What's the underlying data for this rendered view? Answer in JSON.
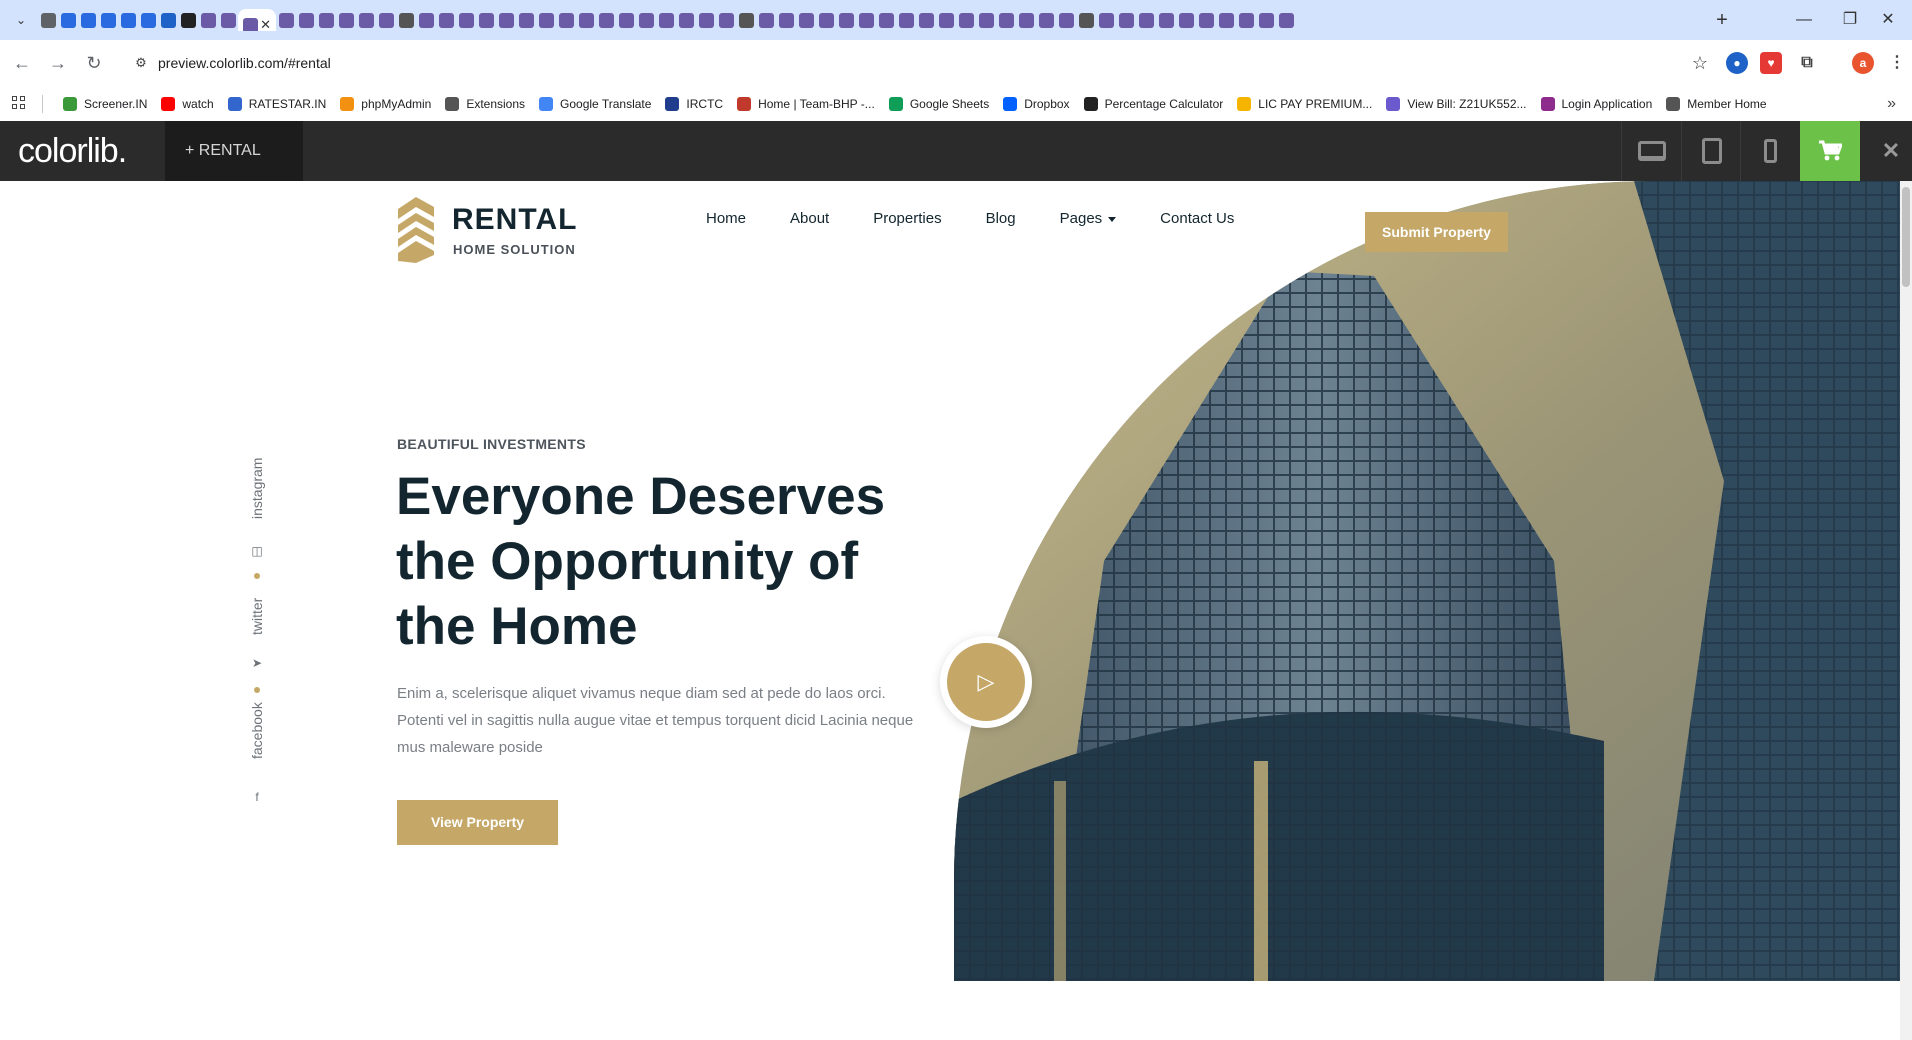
{
  "browser": {
    "colors": {
      "tabstrip": "#d3e3fd",
      "toolbar": "#ffffff"
    },
    "url": "preview.colorlib.com/#rental",
    "active_tab_close": "✕",
    "new_tab": "+",
    "window": {
      "minimize": "—",
      "restore": "❐",
      "close": "✕"
    },
    "nav": {
      "back": "←",
      "forward": "→",
      "reload": "↻"
    },
    "star": "☆",
    "profile_initial": "a",
    "menu": "⋮",
    "bookmarks": [
      {
        "label": "Screener.IN",
        "icon": "screener-icon",
        "color": "#3a9a3a"
      },
      {
        "label": "watch",
        "icon": "youtube-icon",
        "color": "#ff0000"
      },
      {
        "label": "RATESTAR.IN",
        "icon": "ratestar-icon",
        "color": "#3366cc"
      },
      {
        "label": "phpMyAdmin",
        "icon": "phpmyadmin-icon",
        "color": "#f29111"
      },
      {
        "label": "Extensions",
        "icon": "puzzle-icon",
        "color": "#555555"
      },
      {
        "label": "Google Translate",
        "icon": "translate-icon",
        "color": "#4285f4"
      },
      {
        "label": "IRCTC",
        "icon": "irctc-icon",
        "color": "#1f3d8c"
      },
      {
        "label": "Home | Team-BHP -...",
        "icon": "teambhp-icon",
        "color": "#c0392b"
      },
      {
        "label": "Google Sheets",
        "icon": "sheets-icon",
        "color": "#0f9d58"
      },
      {
        "label": "Dropbox",
        "icon": "dropbox-icon",
        "color": "#0061fe"
      },
      {
        "label": "Percentage Calculator",
        "icon": "calculator-icon",
        "color": "#222222"
      },
      {
        "label": "LIC PAY PREMIUM...",
        "icon": "lic-icon",
        "color": "#f4b400"
      },
      {
        "label": "View Bill: Z21UK552...",
        "icon": "bill-icon",
        "color": "#6a5acd"
      },
      {
        "label": "Login Application",
        "icon": "login-icon",
        "color": "#8e2c8e"
      },
      {
        "label": "Member Home",
        "icon": "globe-icon",
        "color": "#555555"
      }
    ],
    "bookmarks_more": "»"
  },
  "colorlib": {
    "logo": "colorlib.",
    "item": "+  RENTAL",
    "cart_color": "#6cc149",
    "close": "✕"
  },
  "site": {
    "accent": "#c5a868",
    "dark": "#13262f",
    "brand": {
      "title": "RENTAL",
      "subtitle": "HOME SOLUTION"
    },
    "nav": [
      "Home",
      "About",
      "Properties",
      "Blog",
      "Pages",
      "Contact Us"
    ],
    "submit": "Submit Property",
    "kicker": "BEAUTIFUL INVESTMENTS",
    "headline": "Everyone Deserves the Opportunity of the Home",
    "description": "Enim a, scelerisque aliquet vivamus neque diam sed at pede do laos orci. Potenti vel in sagittis nulla augue vitae et tempus torquent dicid Lacinia neque mus maleware poside",
    "cta": "View Property",
    "play": "▷",
    "social": [
      "instagram",
      "twitter",
      "facebook"
    ]
  }
}
